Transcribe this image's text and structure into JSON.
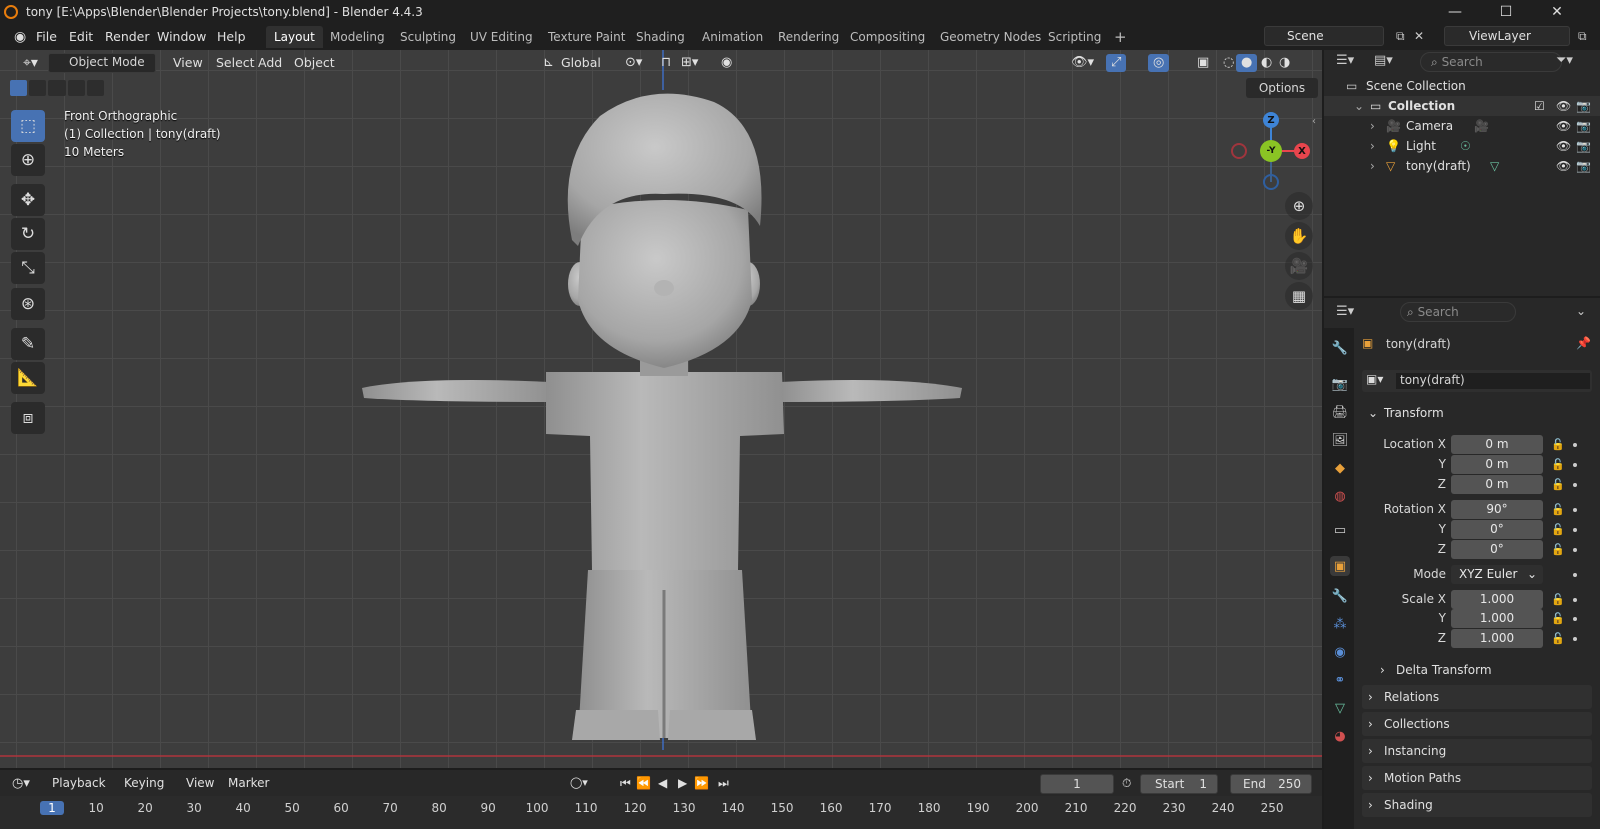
{
  "window": {
    "title": "tony [E:\\Apps\\Blender\\Blender Projects\\tony.blend] - Blender 4.4.3",
    "minimize_glyph": "—",
    "maximize_glyph": "☐",
    "close_glyph": "✕"
  },
  "menu": [
    "File",
    "Edit",
    "Render",
    "Window",
    "Help"
  ],
  "workspaces": [
    "Layout",
    "Modeling",
    "Sculpting",
    "UV Editing",
    "Texture Paint",
    "Shading",
    "Animation",
    "Rendering",
    "Compositing",
    "Geometry Nodes",
    "Scripting"
  ],
  "active_workspace": "Layout",
  "add_workspace": "+",
  "scene": {
    "name": "Scene",
    "view_layer": "ViewLayer"
  },
  "viewport": {
    "mode": "Object Mode",
    "menus": [
      "View",
      "Select",
      "Add",
      "Object"
    ],
    "transform_orientation": "Global",
    "options_label": "Options",
    "info": [
      "Front Orthographic",
      "(1) Collection | tony(draft)",
      "10 Meters"
    ],
    "gizmo_axes": {
      "z": "Z",
      "y": "-Y",
      "x": "X"
    },
    "colors": {
      "x": "#e8454d",
      "y": "#8ac424",
      "z": "#3e84d6"
    }
  },
  "outliner": {
    "search_placeholder": "Search",
    "root": "Scene Collection",
    "collection": "Collection",
    "items": [
      "Camera",
      "Light",
      "tony(draft)"
    ]
  },
  "properties": {
    "search_placeholder": "Search",
    "object_name": "tony(draft)",
    "datablock_name": "tony(draft)",
    "transform": {
      "header": "Transform",
      "location_label": "Location X",
      "rotation_label": "Rotation X",
      "scale_label": "Scale X",
      "mode_label": "Mode",
      "y_label": "Y",
      "z_label": "Z",
      "location": [
        "0 m",
        "0 m",
        "0 m"
      ],
      "rotation": [
        "90°",
        "0°",
        "0°"
      ],
      "mode": "XYZ Euler",
      "scale": [
        "1.000",
        "1.000",
        "1.000"
      ]
    },
    "delta_transform": "Delta Transform",
    "panels": [
      "Relations",
      "Collections",
      "Instancing",
      "Motion Paths",
      "Shading"
    ]
  },
  "timeline": {
    "menus": [
      "Playback",
      "Keying",
      "View",
      "Marker"
    ],
    "current_frame": "1",
    "start_label": "Start",
    "start": "1",
    "end_label": "End",
    "end": "250",
    "ruler": [
      "1",
      "10",
      "20",
      "30",
      "40",
      "50",
      "60",
      "70",
      "80",
      "90",
      "100",
      "110",
      "120",
      "130",
      "140",
      "150",
      "160",
      "170",
      "180",
      "190",
      "200",
      "210",
      "220",
      "230",
      "240",
      "250"
    ]
  }
}
